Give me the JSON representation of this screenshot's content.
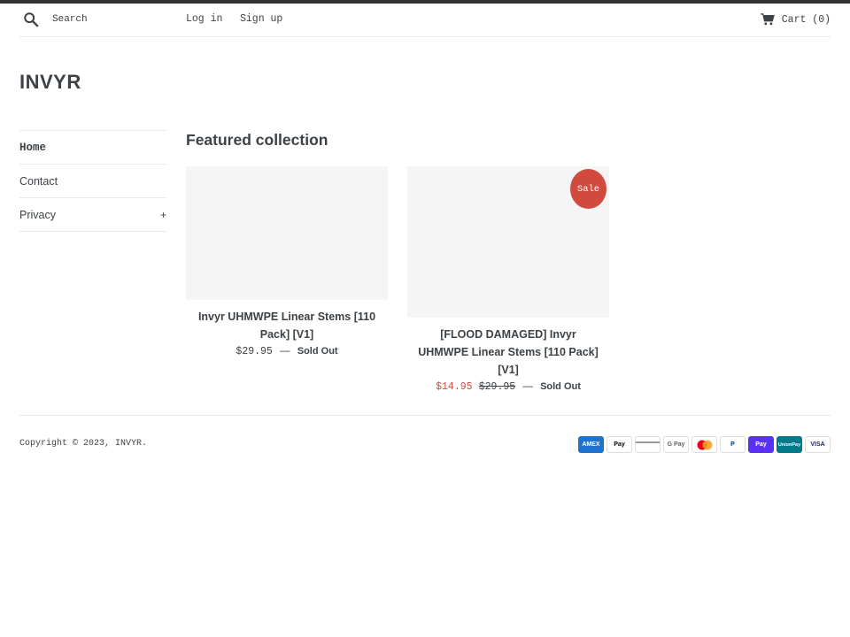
{
  "header": {
    "search_placeholder": "Search",
    "login_label": "Log in",
    "signup_label": "Sign up",
    "cart_label": "Cart (0)"
  },
  "logo": "INVYR",
  "sidebar": {
    "items": [
      {
        "label": "Home"
      },
      {
        "label": "Contact"
      },
      {
        "label": "Privacy",
        "expand": "+"
      }
    ]
  },
  "main": {
    "section_title": "Featured collection",
    "products": [
      {
        "title": "Invyr UHMWPE Linear Stems [110 Pack] [V1]",
        "price": "$29.95",
        "separator": "—",
        "status": "Sold Out"
      },
      {
        "badge": "Sale",
        "title": "[FLOOD DAMAGED] Invyr UHMWPE Linear Stems [110 Pack] [V1]",
        "sale_price": "$14.95",
        "compare_price": "$29.95",
        "separator": "—",
        "status": "Sold Out"
      }
    ]
  },
  "footer": {
    "copyright": "Copyright © 2023, INVYR.",
    "payments": [
      {
        "name": "amex-icon",
        "label": "AMEX",
        "color": "#1f72cd"
      },
      {
        "name": "apple-pay-icon",
        "label": "Pay",
        "color": "#000000"
      },
      {
        "name": "generic-card-icon",
        "label": "",
        "color": "#9a9a9a"
      },
      {
        "name": "google-pay-icon",
        "label": "G Pay",
        "color": "#5f6368"
      },
      {
        "name": "mastercard-icon",
        "label": "",
        "color": "#eb001b"
      },
      {
        "name": "paypal-icon",
        "label": "P",
        "color": "#003087"
      },
      {
        "name": "shop-pay-icon",
        "label": "Pay",
        "color": "#5a31f4"
      },
      {
        "name": "union-pay-icon",
        "label": "UnionPay",
        "color": "#01798a"
      },
      {
        "name": "visa-icon",
        "label": "VISA",
        "color": "#1a1f71"
      }
    ]
  }
}
